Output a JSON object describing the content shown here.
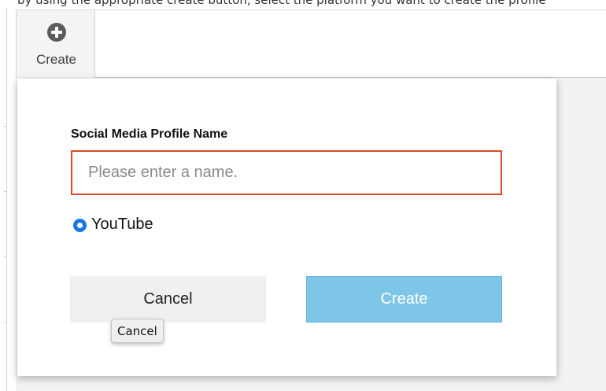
{
  "intro": {
    "text": "by using the appropriate create button, select the platform you want to create the profile"
  },
  "toolbar": {
    "create_icon": "plus-circle-icon",
    "create_label": "Create"
  },
  "dialog": {
    "field_label": "Social Media Profile Name",
    "name_input": {
      "value": "",
      "placeholder": "Please enter a name."
    },
    "platform_options": [
      {
        "label": "YouTube",
        "selected": true
      }
    ],
    "cancel_label": "Cancel",
    "create_label": "Create"
  },
  "tooltip": {
    "text": "Cancel"
  },
  "colors": {
    "input_error_border": "#d94a2b",
    "radio_accent": "#1877e6",
    "create_button_bg": "#7dc6e7",
    "cancel_button_bg": "#f0f0f0"
  }
}
